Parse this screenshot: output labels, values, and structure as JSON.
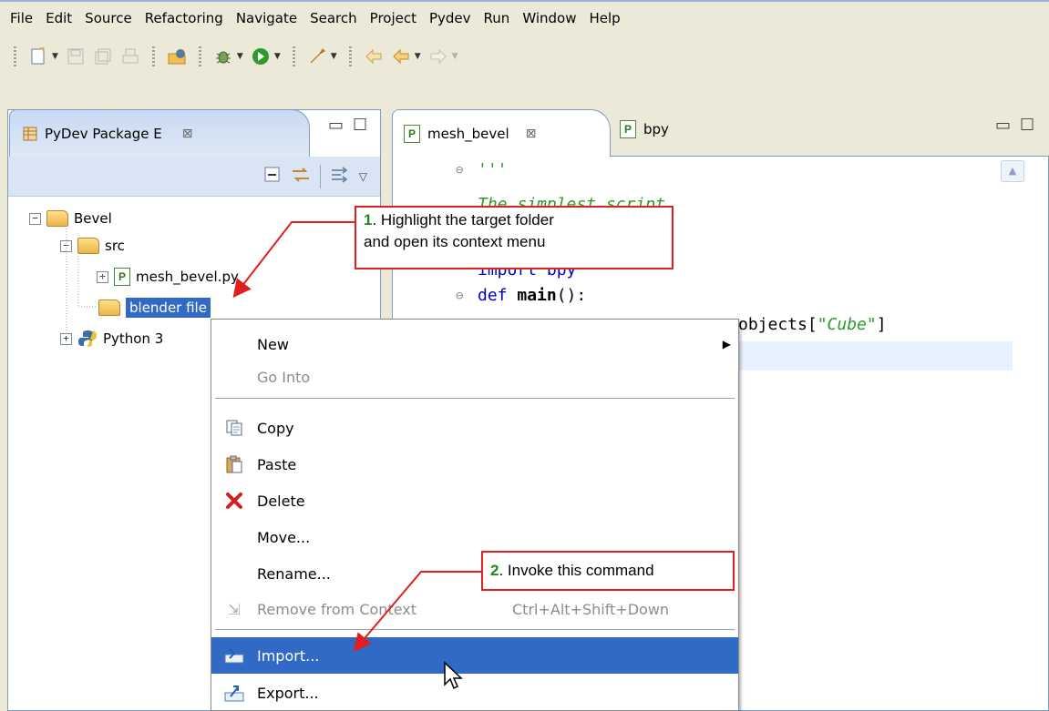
{
  "menubar": [
    "File",
    "Edit",
    "Source",
    "Refactoring",
    "Navigate",
    "Search",
    "Project",
    "Pydev",
    "Run",
    "Window",
    "Help"
  ],
  "package_view": {
    "tab_title": "PyDev Package E",
    "tree": [
      {
        "label": "Bevel"
      },
      {
        "label": "src"
      },
      {
        "label": "mesh_bevel.py"
      },
      {
        "label": "blender file"
      },
      {
        "label": "Python 3"
      }
    ]
  },
  "editor": {
    "tabs": [
      "mesh_bevel",
      "bpy"
    ],
    "code": {
      "l0": "'''",
      "l1": "The simplest script",
      "l3": "import bpy",
      "l4a": "def ",
      "l4b": "main",
      "l4c": "():",
      "l5a": "objects[",
      "l5b": "\"Cube\"",
      "l5c": "]"
    }
  },
  "context_menu": {
    "new": "New",
    "go_into": "Go Into",
    "copy": "Copy",
    "paste": "Paste",
    "delete": "Delete",
    "move": "Move...",
    "rename": "Rename...",
    "remove_context": "Remove from Context",
    "remove_context_shortcut": "Ctrl+Alt+Shift+Down",
    "import": "Import...",
    "export": "Export..."
  },
  "annotations": {
    "a1_num": "1",
    "a1_line1": ". Highlight the target folder",
    "a1_line2": "and open its context menu",
    "a2_num": "2",
    "a2_text": ". Invoke this command",
    "color": "#e02020"
  }
}
